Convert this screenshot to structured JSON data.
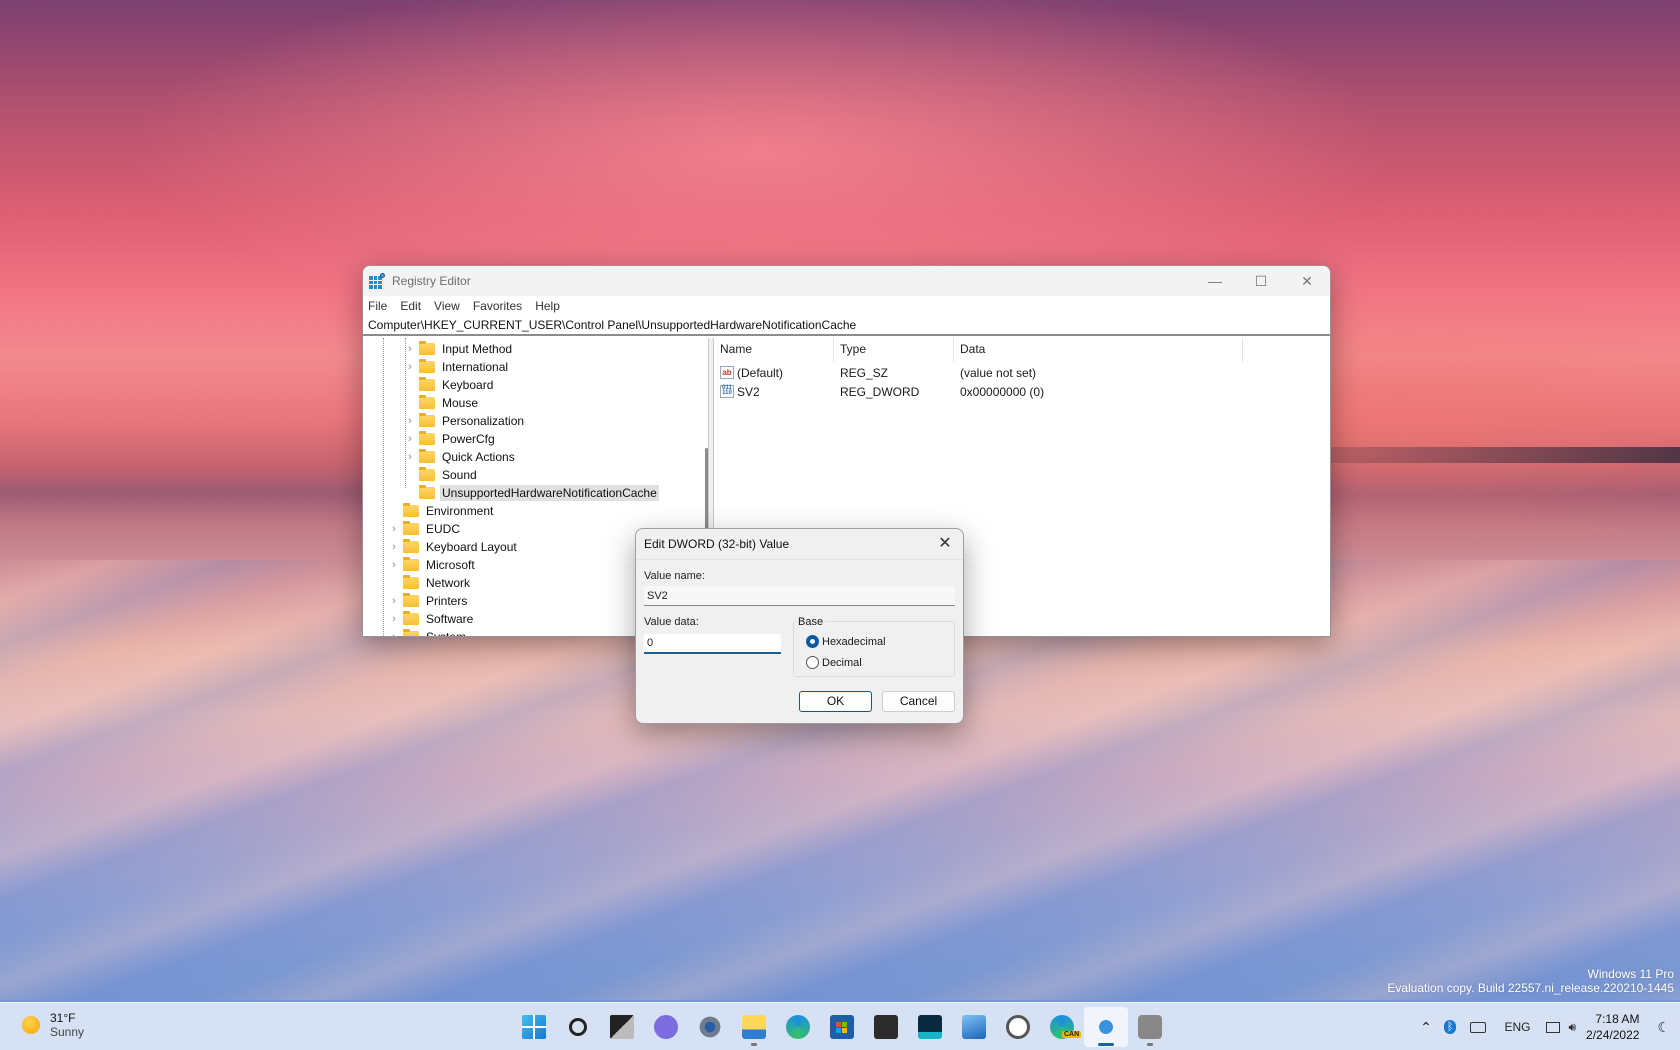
{
  "registry_editor": {
    "title": "Registry Editor",
    "window_controls": {
      "minimize": "—",
      "maximize": "☐",
      "close": "✕"
    },
    "menu": [
      "File",
      "Edit",
      "View",
      "Favorites",
      "Help"
    ],
    "address": "Computer\\HKEY_CURRENT_USER\\Control Panel\\UnsupportedHardwareNotificationCache",
    "tree": [
      {
        "label": "Input Method",
        "level": 2,
        "expandable": true
      },
      {
        "label": "International",
        "level": 2,
        "expandable": true
      },
      {
        "label": "Keyboard",
        "level": 2,
        "expandable": false
      },
      {
        "label": "Mouse",
        "level": 2,
        "expandable": false
      },
      {
        "label": "Personalization",
        "level": 2,
        "expandable": true
      },
      {
        "label": "PowerCfg",
        "level": 2,
        "expandable": true
      },
      {
        "label": "Quick Actions",
        "level": 2,
        "expandable": true
      },
      {
        "label": "Sound",
        "level": 2,
        "expandable": false
      },
      {
        "label": "UnsupportedHardwareNotificationCache",
        "level": 2,
        "expandable": false,
        "selected": true
      },
      {
        "label": "Environment",
        "level": 1,
        "expandable": false
      },
      {
        "label": "EUDC",
        "level": 1,
        "expandable": true
      },
      {
        "label": "Keyboard Layout",
        "level": 1,
        "expandable": true
      },
      {
        "label": "Microsoft",
        "level": 1,
        "expandable": true
      },
      {
        "label": "Network",
        "level": 1,
        "expandable": false
      },
      {
        "label": "Printers",
        "level": 1,
        "expandable": true
      },
      {
        "label": "Software",
        "level": 1,
        "expandable": true
      },
      {
        "label": "System",
        "level": 1,
        "expandable": true
      }
    ],
    "columns": {
      "name": "Name",
      "type": "Type",
      "data": "Data"
    },
    "values": [
      {
        "icon": "string-value-icon",
        "icon_text": "ab",
        "name": "(Default)",
        "type": "REG_SZ",
        "data": "(value not set)"
      },
      {
        "icon": "binary-value-icon",
        "icon_text": "011 110",
        "name": "SV2",
        "type": "REG_DWORD",
        "data": "0x00000000 (0)"
      }
    ]
  },
  "dialog": {
    "title": "Edit DWORD (32-bit) Value",
    "close": "✕",
    "value_name_label": "Value name:",
    "value_name": "SV2",
    "value_data_label": "Value data:",
    "value_data": "0",
    "base_label": "Base",
    "base_options": [
      {
        "label": "Hexadecimal",
        "checked": true
      },
      {
        "label": "Decimal",
        "checked": false
      }
    ],
    "ok": "OK",
    "cancel": "Cancel"
  },
  "watermark": {
    "line1": "Windows 11 Pro",
    "line2": "Evaluation copy. Build 22557.ni_release.220210-1445"
  },
  "taskbar": {
    "weather": {
      "temp": "31°F",
      "condition": "Sunny"
    },
    "apps": [
      {
        "name": "start",
        "running": false,
        "active": false
      },
      {
        "name": "search",
        "running": false,
        "active": false
      },
      {
        "name": "task-view",
        "running": false,
        "active": false
      },
      {
        "name": "chat",
        "running": false,
        "active": false
      },
      {
        "name": "settings",
        "running": false,
        "active": false
      },
      {
        "name": "file-explorer",
        "running": true,
        "active": false
      },
      {
        "name": "edge",
        "running": false,
        "active": false
      },
      {
        "name": "store",
        "running": false,
        "active": false
      },
      {
        "name": "terminal",
        "running": false,
        "active": false
      },
      {
        "name": "dev-home",
        "running": false,
        "active": false
      },
      {
        "name": "photos",
        "running": false,
        "active": false
      },
      {
        "name": "clock",
        "running": false,
        "active": false
      },
      {
        "name": "edge-canary",
        "running": false,
        "active": false,
        "badge": "CAN"
      },
      {
        "name": "registry-editor",
        "running": true,
        "active": true
      },
      {
        "name": "camera",
        "running": true,
        "active": false
      }
    ],
    "tray": {
      "language": "ENG",
      "time": "7:18 AM",
      "date": "2/24/2022"
    }
  }
}
